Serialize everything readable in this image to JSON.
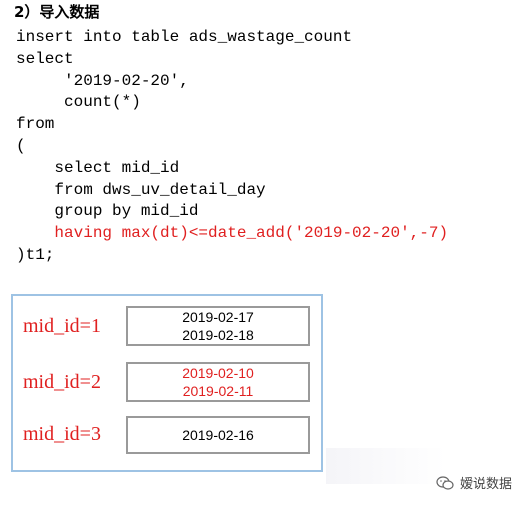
{
  "heading": "2）导入数据",
  "code_lines": [
    "insert into table ads_wastage_count",
    "select",
    "     '2019-02-20',",
    "     count(*)",
    "from",
    "(",
    "    select mid_id",
    "    from dws_uv_detail_day",
    "    group by mid_id",
    "    having max(dt)<=date_add('2019-02-20',-7)",
    ")t1;"
  ],
  "highlight_color": "#e02020",
  "diagram": {
    "rows": [
      {
        "label": "mid_id=1",
        "dates": [
          "2019-02-17",
          "2019-02-18"
        ],
        "dates_color": "black"
      },
      {
        "label": "mid_id=2",
        "dates": [
          "2019-02-10",
          "2019-02-11"
        ],
        "dates_color": "red"
      },
      {
        "label": "mid_id=3",
        "dates": [
          "2019-02-16"
        ],
        "dates_color": "black"
      }
    ]
  },
  "watermark": {
    "text": "嫒说数据",
    "icon": "wechat-icon"
  }
}
